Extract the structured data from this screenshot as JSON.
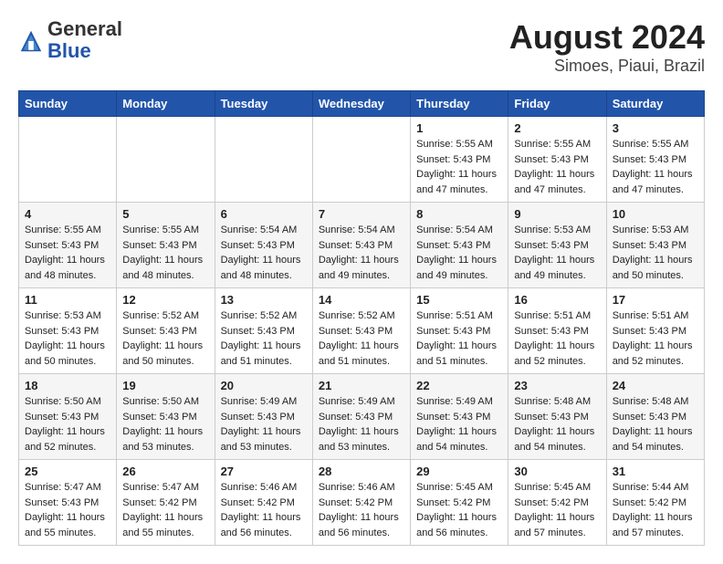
{
  "header": {
    "logo_general": "General",
    "logo_blue": "Blue",
    "title": "August 2024",
    "subtitle": "Simoes, Piaui, Brazil"
  },
  "days_of_week": [
    "Sunday",
    "Monday",
    "Tuesday",
    "Wednesday",
    "Thursday",
    "Friday",
    "Saturday"
  ],
  "weeks": [
    [
      {
        "day": "",
        "info": ""
      },
      {
        "day": "",
        "info": ""
      },
      {
        "day": "",
        "info": ""
      },
      {
        "day": "",
        "info": ""
      },
      {
        "day": "1",
        "info": "Sunrise: 5:55 AM\nSunset: 5:43 PM\nDaylight: 11 hours and 47 minutes."
      },
      {
        "day": "2",
        "info": "Sunrise: 5:55 AM\nSunset: 5:43 PM\nDaylight: 11 hours and 47 minutes."
      },
      {
        "day": "3",
        "info": "Sunrise: 5:55 AM\nSunset: 5:43 PM\nDaylight: 11 hours and 47 minutes."
      }
    ],
    [
      {
        "day": "4",
        "info": "Sunrise: 5:55 AM\nSunset: 5:43 PM\nDaylight: 11 hours and 48 minutes."
      },
      {
        "day": "5",
        "info": "Sunrise: 5:55 AM\nSunset: 5:43 PM\nDaylight: 11 hours and 48 minutes."
      },
      {
        "day": "6",
        "info": "Sunrise: 5:54 AM\nSunset: 5:43 PM\nDaylight: 11 hours and 48 minutes."
      },
      {
        "day": "7",
        "info": "Sunrise: 5:54 AM\nSunset: 5:43 PM\nDaylight: 11 hours and 49 minutes."
      },
      {
        "day": "8",
        "info": "Sunrise: 5:54 AM\nSunset: 5:43 PM\nDaylight: 11 hours and 49 minutes."
      },
      {
        "day": "9",
        "info": "Sunrise: 5:53 AM\nSunset: 5:43 PM\nDaylight: 11 hours and 49 minutes."
      },
      {
        "day": "10",
        "info": "Sunrise: 5:53 AM\nSunset: 5:43 PM\nDaylight: 11 hours and 50 minutes."
      }
    ],
    [
      {
        "day": "11",
        "info": "Sunrise: 5:53 AM\nSunset: 5:43 PM\nDaylight: 11 hours and 50 minutes."
      },
      {
        "day": "12",
        "info": "Sunrise: 5:52 AM\nSunset: 5:43 PM\nDaylight: 11 hours and 50 minutes."
      },
      {
        "day": "13",
        "info": "Sunrise: 5:52 AM\nSunset: 5:43 PM\nDaylight: 11 hours and 51 minutes."
      },
      {
        "day": "14",
        "info": "Sunrise: 5:52 AM\nSunset: 5:43 PM\nDaylight: 11 hours and 51 minutes."
      },
      {
        "day": "15",
        "info": "Sunrise: 5:51 AM\nSunset: 5:43 PM\nDaylight: 11 hours and 51 minutes."
      },
      {
        "day": "16",
        "info": "Sunrise: 5:51 AM\nSunset: 5:43 PM\nDaylight: 11 hours and 52 minutes."
      },
      {
        "day": "17",
        "info": "Sunrise: 5:51 AM\nSunset: 5:43 PM\nDaylight: 11 hours and 52 minutes."
      }
    ],
    [
      {
        "day": "18",
        "info": "Sunrise: 5:50 AM\nSunset: 5:43 PM\nDaylight: 11 hours and 52 minutes."
      },
      {
        "day": "19",
        "info": "Sunrise: 5:50 AM\nSunset: 5:43 PM\nDaylight: 11 hours and 53 minutes."
      },
      {
        "day": "20",
        "info": "Sunrise: 5:49 AM\nSunset: 5:43 PM\nDaylight: 11 hours and 53 minutes."
      },
      {
        "day": "21",
        "info": "Sunrise: 5:49 AM\nSunset: 5:43 PM\nDaylight: 11 hours and 53 minutes."
      },
      {
        "day": "22",
        "info": "Sunrise: 5:49 AM\nSunset: 5:43 PM\nDaylight: 11 hours and 54 minutes."
      },
      {
        "day": "23",
        "info": "Sunrise: 5:48 AM\nSunset: 5:43 PM\nDaylight: 11 hours and 54 minutes."
      },
      {
        "day": "24",
        "info": "Sunrise: 5:48 AM\nSunset: 5:43 PM\nDaylight: 11 hours and 54 minutes."
      }
    ],
    [
      {
        "day": "25",
        "info": "Sunrise: 5:47 AM\nSunset: 5:43 PM\nDaylight: 11 hours and 55 minutes."
      },
      {
        "day": "26",
        "info": "Sunrise: 5:47 AM\nSunset: 5:42 PM\nDaylight: 11 hours and 55 minutes."
      },
      {
        "day": "27",
        "info": "Sunrise: 5:46 AM\nSunset: 5:42 PM\nDaylight: 11 hours and 56 minutes."
      },
      {
        "day": "28",
        "info": "Sunrise: 5:46 AM\nSunset: 5:42 PM\nDaylight: 11 hours and 56 minutes."
      },
      {
        "day": "29",
        "info": "Sunrise: 5:45 AM\nSunset: 5:42 PM\nDaylight: 11 hours and 56 minutes."
      },
      {
        "day": "30",
        "info": "Sunrise: 5:45 AM\nSunset: 5:42 PM\nDaylight: 11 hours and 57 minutes."
      },
      {
        "day": "31",
        "info": "Sunrise: 5:44 AM\nSunset: 5:42 PM\nDaylight: 11 hours and 57 minutes."
      }
    ]
  ]
}
